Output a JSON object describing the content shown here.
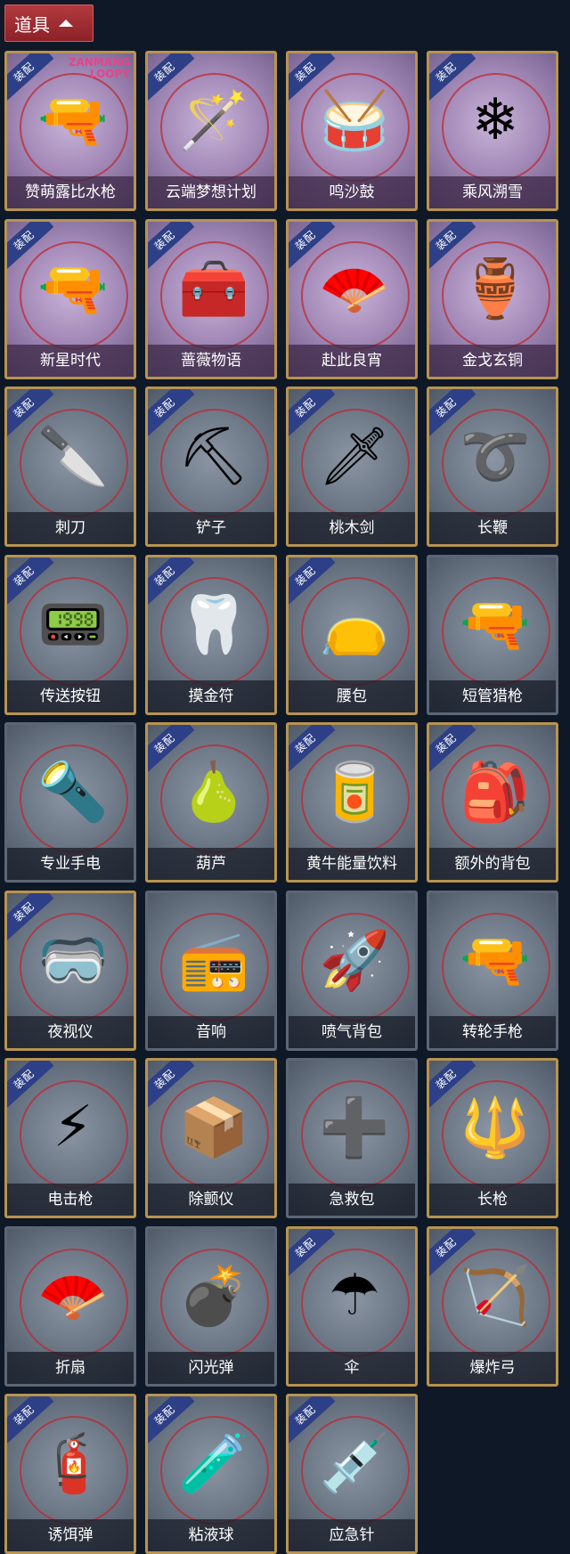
{
  "header": {
    "title": "道具"
  },
  "equip_tag": "装配",
  "items": [
    {
      "name": "赞萌露比水枪",
      "frame": "gold",
      "bg": "purple",
      "equipped": true,
      "icon": "water-gun-icon",
      "glyph": "🔫",
      "watermark": "ZANMANG LOOPY"
    },
    {
      "name": "云端梦想计划",
      "frame": "gold",
      "bg": "purple",
      "equipped": true,
      "icon": "magic-wand-icon",
      "glyph": "🪄"
    },
    {
      "name": "鸣沙鼓",
      "frame": "gold",
      "bg": "purple",
      "equipped": true,
      "icon": "drum-icon",
      "glyph": "🥁"
    },
    {
      "name": "乘风溯雪",
      "frame": "gold",
      "bg": "purple",
      "equipped": true,
      "icon": "snow-device-icon",
      "glyph": "❄"
    },
    {
      "name": "新星时代",
      "frame": "gold",
      "bg": "purple",
      "equipped": true,
      "icon": "revolver-icon",
      "glyph": "🔫"
    },
    {
      "name": "蔷薇物语",
      "frame": "gold",
      "bg": "purple",
      "equipped": true,
      "icon": "medkit-icon",
      "glyph": "🧰"
    },
    {
      "name": "赴此良宵",
      "frame": "gold",
      "bg": "purple",
      "equipped": true,
      "icon": "fan-icon",
      "glyph": "🪭"
    },
    {
      "name": "金戈玄铜",
      "frame": "gold",
      "bg": "purple",
      "equipped": true,
      "icon": "bronze-grenade-icon",
      "glyph": "🏺"
    },
    {
      "name": "刺刀",
      "frame": "gold",
      "bg": "gray",
      "equipped": true,
      "icon": "knife-icon",
      "glyph": "🔪"
    },
    {
      "name": "铲子",
      "frame": "gold",
      "bg": "gray",
      "equipped": true,
      "icon": "shovel-icon",
      "glyph": "⛏"
    },
    {
      "name": "桃木剑",
      "frame": "gold",
      "bg": "gray",
      "equipped": true,
      "icon": "wooden-sword-icon",
      "glyph": "🗡"
    },
    {
      "name": "长鞭",
      "frame": "gold",
      "bg": "gray",
      "equipped": true,
      "icon": "whip-icon",
      "glyph": "➰"
    },
    {
      "name": "传送按钮",
      "frame": "gold",
      "bg": "gray",
      "equipped": true,
      "icon": "remote-button-icon",
      "glyph": "📟"
    },
    {
      "name": "摸金符",
      "frame": "gold",
      "bg": "gray",
      "equipped": true,
      "icon": "amulet-icon",
      "glyph": "🦷"
    },
    {
      "name": "腰包",
      "frame": "gold",
      "bg": "gray",
      "equipped": true,
      "icon": "waist-bag-icon",
      "glyph": "👝"
    },
    {
      "name": "短管猎枪",
      "frame": "plain",
      "bg": "gray",
      "equipped": false,
      "icon": "shotgun-icon",
      "glyph": "🔫"
    },
    {
      "name": "专业手电",
      "frame": "plain",
      "bg": "gray",
      "equipped": false,
      "icon": "flashlight-icon",
      "glyph": "🔦"
    },
    {
      "name": "葫芦",
      "frame": "gold",
      "bg": "gray",
      "equipped": true,
      "icon": "gourd-icon",
      "glyph": "🍐"
    },
    {
      "name": "黄牛能量饮料",
      "frame": "gold",
      "bg": "gray",
      "equipped": true,
      "icon": "energy-drink-icon",
      "glyph": "🥫"
    },
    {
      "name": "额外的背包",
      "frame": "gold",
      "bg": "gray",
      "equipped": true,
      "icon": "backpack-icon",
      "glyph": "🎒"
    },
    {
      "name": "夜视仪",
      "frame": "gold",
      "bg": "gray",
      "equipped": true,
      "icon": "night-vision-icon",
      "glyph": "🥽"
    },
    {
      "name": "音响",
      "frame": "plain",
      "bg": "gray",
      "equipped": false,
      "icon": "radio-icon",
      "glyph": "📻"
    },
    {
      "name": "喷气背包",
      "frame": "plain",
      "bg": "gray",
      "equipped": false,
      "icon": "jetpack-icon",
      "glyph": "🚀"
    },
    {
      "name": "转轮手枪",
      "frame": "plain",
      "bg": "gray",
      "equipped": false,
      "icon": "revolver-icon",
      "glyph": "🔫"
    },
    {
      "name": "电击枪",
      "frame": "gold",
      "bg": "gray",
      "equipped": true,
      "icon": "taser-icon",
      "glyph": "⚡"
    },
    {
      "name": "除颤仪",
      "frame": "gold",
      "bg": "gray",
      "equipped": true,
      "icon": "defibrillator-icon",
      "glyph": "📦"
    },
    {
      "name": "急救包",
      "frame": "plain",
      "bg": "gray",
      "equipped": false,
      "icon": "first-aid-icon",
      "glyph": "➕"
    },
    {
      "name": "长枪",
      "frame": "gold",
      "bg": "gray",
      "equipped": true,
      "icon": "spear-icon",
      "glyph": "🔱"
    },
    {
      "name": "折扇",
      "frame": "plain",
      "bg": "gray",
      "equipped": false,
      "icon": "folding-fan-icon",
      "glyph": "🪭"
    },
    {
      "name": "闪光弹",
      "frame": "plain",
      "bg": "gray",
      "equipped": false,
      "icon": "flashbang-icon",
      "glyph": "💣"
    },
    {
      "name": "伞",
      "frame": "gold",
      "bg": "gray",
      "equipped": true,
      "icon": "umbrella-icon",
      "glyph": "☂"
    },
    {
      "name": "爆炸弓",
      "frame": "gold",
      "bg": "gray",
      "equipped": true,
      "icon": "bow-icon",
      "glyph": "🏹"
    },
    {
      "name": "诱饵弹",
      "frame": "gold",
      "bg": "gray",
      "equipped": true,
      "icon": "decoy-canister-icon",
      "glyph": "🧯"
    },
    {
      "name": "粘液球",
      "frame": "gold",
      "bg": "gray",
      "equipped": true,
      "icon": "slime-jar-icon",
      "glyph": "🧪"
    },
    {
      "name": "应急针",
      "frame": "gold",
      "bg": "gray",
      "equipped": true,
      "icon": "syringe-icon",
      "glyph": "💉"
    }
  ]
}
